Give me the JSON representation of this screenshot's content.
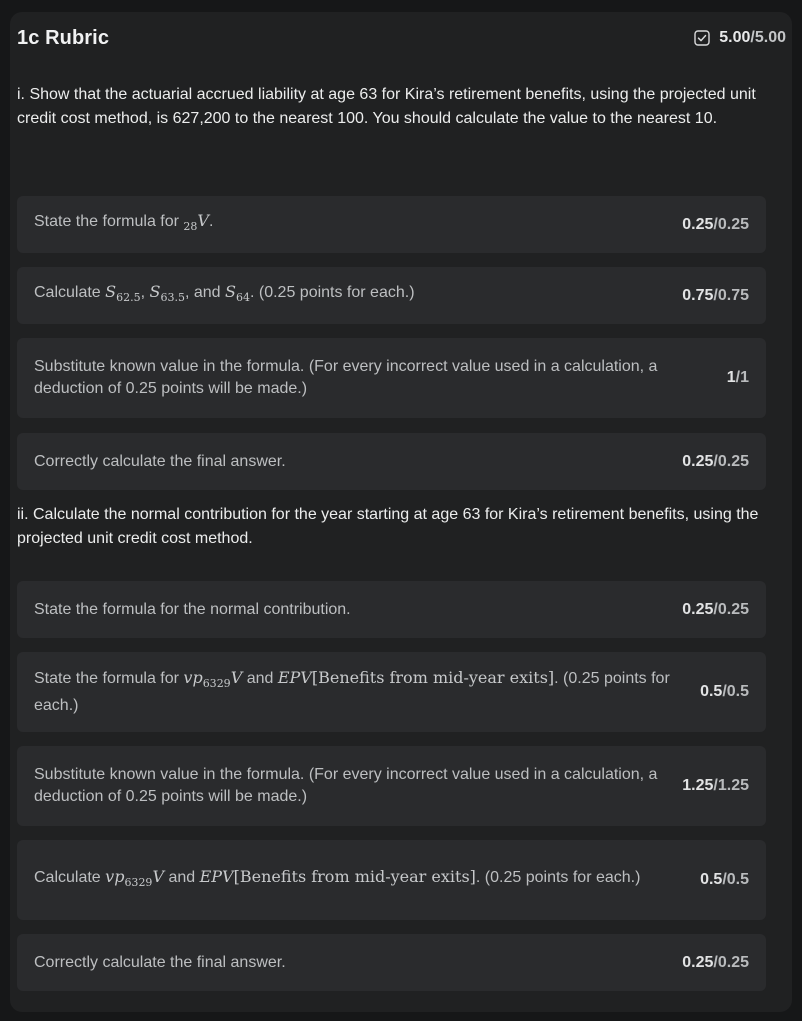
{
  "header": {
    "title": "1c Rubric",
    "score": "5.00",
    "score_max": "/5.00"
  },
  "questions": [
    {
      "text": "i. Show that the actuarial accrued liability at age 63 for Kira’s retirement benefits, using the projected unit credit cost method, is 627,200 to the nearest 100. You should calculate the value to the nearest 10.",
      "criteria": [
        {
          "pre": "State the formula for ",
          "math": [
            {
              "sub_pre": "28",
              "base": "V"
            }
          ],
          "post": ".",
          "score": "0.25",
          "max": "/0.25"
        },
        {
          "pre": "Calculate ",
          "math_text": {
            "s1": "S",
            "s1_sub": "62.5",
            "s2": "S",
            "s2_sub": "63.5",
            "s3": "S",
            "s3_sub": "64",
            "sep1": ", ",
            "sep2": ", and "
          },
          "post": ". (0.25 points for each.)",
          "score": "0.75",
          "max": "/0.75"
        },
        {
          "pre": "Substitute known value in the formula. (For every incorrect value used in a calculation, a deduction of 0.25 points will be made.)",
          "score": "1",
          "max": "/1"
        },
        {
          "pre": "Correctly calculate the final answer.",
          "score": "0.25",
          "max": "/0.25"
        }
      ]
    },
    {
      "text": "ii. Calculate the normal contribution for the year starting at age 63 for Kira’s retirement benefits, using the projected unit credit cost method.",
      "criteria": [
        {
          "pre": "State the formula for the normal contribution.",
          "score": "0.25",
          "max": "/0.25"
        },
        {
          "pre": "State the formula for ",
          "vp": {
            "v": "vp",
            "sub": "63",
            "sub2": "29",
            "V": "V"
          },
          "mid": " and ",
          "epv": {
            "name": "EPV",
            "arg": "[Benefits from mid-year exits]"
          },
          "post": ". (0.25 points for each.)",
          "score": "0.5",
          "max": "/0.5"
        },
        {
          "pre": "Substitute known value in the formula. (For every incorrect value used in a calculation, a deduction of 0.25 points will be made.)",
          "score": "1.25",
          "max": "/1.25"
        },
        {
          "pre": "Calculate ",
          "vp": {
            "v": "vp",
            "sub": "63",
            "sub2": "29",
            "V": "V"
          },
          "mid": " and ",
          "epv": {
            "name": "EPV",
            "arg": "[Benefits from mid-year exits]"
          },
          "post": ". (0.25 points for each.)",
          "score": "0.5",
          "max": "/0.5"
        },
        {
          "pre": "Correctly calculate the final answer.",
          "score": "0.25",
          "max": "/0.25"
        }
      ]
    }
  ]
}
